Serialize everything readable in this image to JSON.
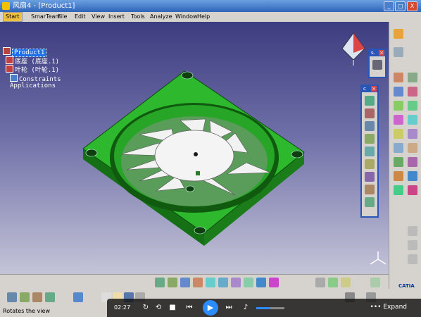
{
  "window": {
    "title": "风扇4 - [Product1]",
    "min": "_",
    "max": "□",
    "close": "X"
  },
  "menu": {
    "start": "Start",
    "items": [
      "SmarTeam",
      "File",
      "Edit",
      "View",
      "Insert",
      "Tools",
      "Analyze",
      "Window",
      "Help"
    ]
  },
  "tree": {
    "root": "Product1",
    "children": [
      "底座 (底座.1)",
      "叶轮 (叶轮.1)",
      "Constraints",
      "Applications"
    ]
  },
  "floating_toolbars": {
    "small": "s.",
    "tall": "c"
  },
  "status": {
    "text": "Rotates the view",
    "brand": "CATIA"
  },
  "player": {
    "time": "02:27",
    "more": "••• Expand"
  },
  "colors": {
    "model": "#2db82d",
    "blade": "#f2f2f2",
    "accent": "#2b8cff"
  }
}
